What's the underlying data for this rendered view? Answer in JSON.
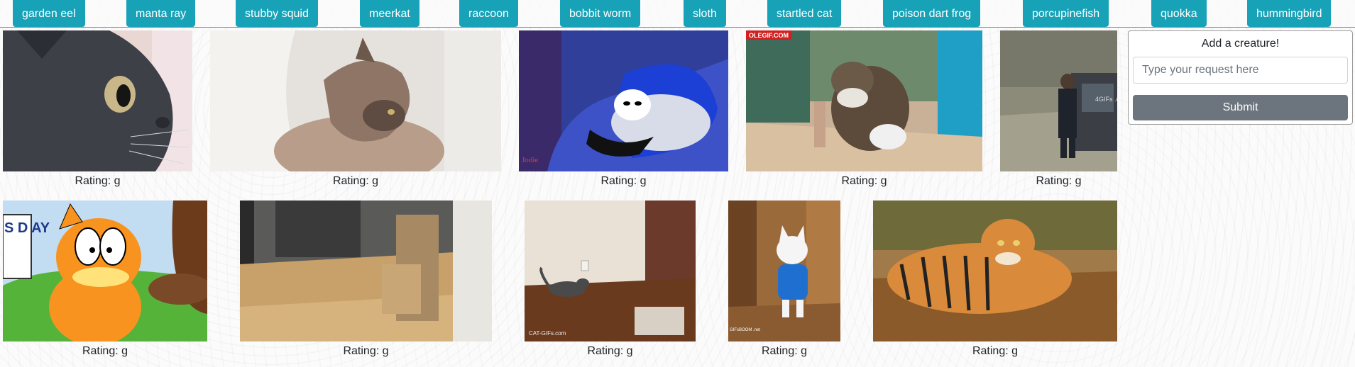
{
  "nav": {
    "buttons": [
      "garden eel",
      "manta ray",
      "stubby squid",
      "meerkat",
      "raccoon",
      "bobbit worm",
      "sloth",
      "startled cat",
      "poison dart frog",
      "porcupinefish",
      "quokka",
      "hummingbird"
    ]
  },
  "gifs": [
    {
      "caption": "Rating: g",
      "subject": "gray cat close-up"
    },
    {
      "caption": "Rating: g",
      "subject": "two cats cuddling on fur blanket"
    },
    {
      "caption": "Rating: g",
      "subject": "cartoon cat sleeping on pillow",
      "watermark": "Jodie"
    },
    {
      "caption": "Rating: g",
      "subject": "cat near can on wooden floor",
      "badge": "OLEGIF.COM"
    },
    {
      "caption": "Rating: g",
      "subject": "police officer next to car",
      "watermark": "4GIFs .com"
    },
    {
      "caption": "Rating: g",
      "subject": "Garfield cartoon",
      "sign_text": "S D AY"
    },
    {
      "caption": "Rating: g",
      "subject": "hallway with cardboard box"
    },
    {
      "caption": "Rating: g",
      "subject": "cat walking on floor",
      "watermark": "CAT-GIFs.com"
    },
    {
      "caption": "Rating: g",
      "subject": "white cat in blue sweater",
      "watermark": "GIFsBOOM .net"
    },
    {
      "caption": "Rating: g",
      "subject": "tiger on dry leaves"
    }
  ],
  "form": {
    "title": "Add a creature!",
    "placeholder": "Type your request here",
    "submit_label": "Submit"
  },
  "colors": {
    "nav_button": "#17a2b8",
    "submit_button": "#6c757d"
  }
}
